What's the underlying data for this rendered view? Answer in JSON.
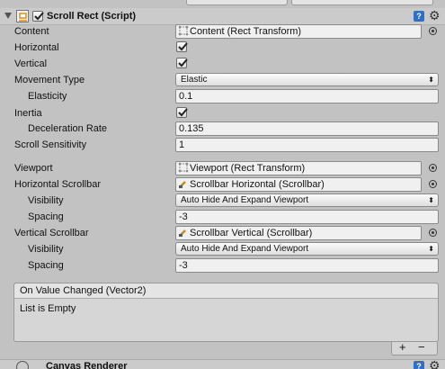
{
  "component": {
    "title": "Scroll Rect (Script)",
    "enabled": true,
    "icons": {
      "fold": "foldout-triangle-icon",
      "script": "script-component-icon",
      "help": "help-book-icon",
      "settings": "gear-icon"
    }
  },
  "fields": {
    "content": {
      "label": "Content",
      "value": "Content (Rect Transform)",
      "icon": "rect-transform-icon"
    },
    "horizontal": {
      "label": "Horizontal",
      "checked": true
    },
    "vertical": {
      "label": "Vertical",
      "checked": true
    },
    "movement_type": {
      "label": "Movement Type",
      "value": "Elastic"
    },
    "elasticity": {
      "label": "Elasticity",
      "value": "0.1"
    },
    "inertia": {
      "label": "Inertia",
      "checked": true
    },
    "deceleration_rate": {
      "label": "Deceleration Rate",
      "value": "0.135"
    },
    "scroll_sensitivity": {
      "label": "Scroll Sensitivity",
      "value": "1"
    },
    "viewport": {
      "label": "Viewport",
      "value": "Viewport (Rect Transform)",
      "icon": "rect-transform-icon"
    },
    "horizontal_scrollbar": {
      "label": "Horizontal Scrollbar",
      "value": "Scrollbar Horizontal (Scrollbar)",
      "icon": "scrollbar-icon"
    },
    "h_visibility": {
      "label": "Visibility",
      "value": "Auto Hide And Expand Viewport"
    },
    "h_spacing": {
      "label": "Spacing",
      "value": "-3"
    },
    "vertical_scrollbar": {
      "label": "Vertical Scrollbar",
      "value": "Scrollbar Vertical (Scrollbar)",
      "icon": "scrollbar-icon"
    },
    "v_visibility": {
      "label": "Visibility",
      "value": "Auto Hide And Expand Viewport"
    },
    "v_spacing": {
      "label": "Spacing",
      "value": "-3"
    }
  },
  "event": {
    "header": "On Value Changed (Vector2)",
    "body": "List is Empty",
    "add_label": "+",
    "remove_label": "−"
  },
  "next_component": {
    "title": "Canvas Renderer"
  },
  "colors": {
    "bg": "#c2c2c2",
    "field": "#f0f0f0",
    "accent": "#2f6fc4"
  }
}
